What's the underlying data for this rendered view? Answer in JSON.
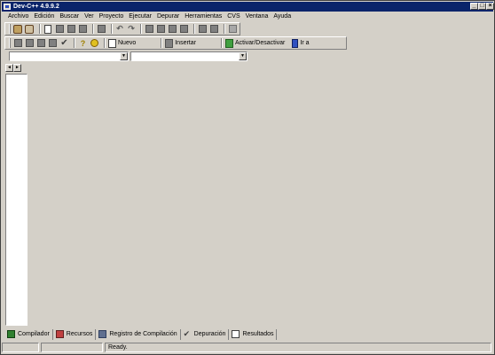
{
  "window": {
    "title": "Dev-C++ 4.9.9.2"
  },
  "menu": [
    "Archivo",
    "Edición",
    "Buscar",
    "Ver",
    "Proyecto",
    "Ejecutar",
    "Depurar",
    "Herramientas",
    "CVS",
    "Ventana",
    "Ayuda"
  ],
  "toolbar2": {
    "nuevo_label": "Nuevo",
    "insertar_label": "Insertar",
    "activar_label": "Activar/Desactivar",
    "ir_label": "Ir a"
  },
  "combos": {
    "left_value": "",
    "right_value": ""
  },
  "bottom_tabs": [
    "Compilador",
    "Recursos",
    "Registro de Compilación",
    "Depuración",
    "Resultados"
  ],
  "status": {
    "cell1": "",
    "cell2": "",
    "cell3": "Ready."
  },
  "colors": {
    "title_bar": "#0a246a",
    "face": "#d4d0c8",
    "panel": "#ffffff"
  },
  "icons": {
    "toolbar1": [
      "project-icon",
      "class-browser-icon",
      "new-file-icon",
      "open-icon",
      "save-icon",
      "save-all-icon",
      "print-icon",
      "undo-icon",
      "redo-icon",
      "find-icon",
      "replace-icon",
      "find-next-icon",
      "goto-line-icon",
      "indent-icon",
      "unindent-icon",
      "toggle-bookmark-icon"
    ],
    "toolbar2": [
      "compile-icon",
      "run-icon",
      "compile-run-icon",
      "rebuild-icon",
      "check-icon",
      "help-icon",
      "about-icon"
    ]
  }
}
